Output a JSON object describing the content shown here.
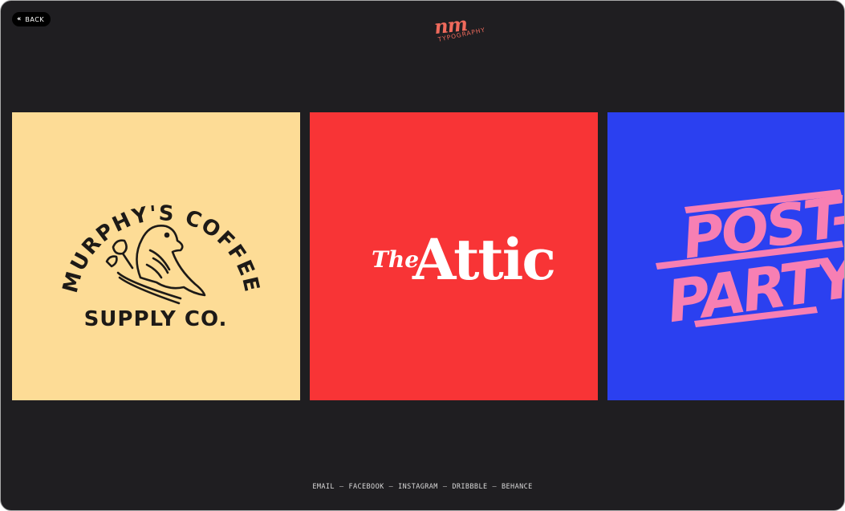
{
  "header": {
    "back_label": "BACK",
    "logo_mark": "nm",
    "logo_word": "TYPOGRAPHY"
  },
  "cards": [
    {
      "name": "murphys-coffee",
      "line1": "MURPHY'S COFFEE",
      "line2": "SUPPLY CO.",
      "background": "#fddc96",
      "ink": "#1d1a17"
    },
    {
      "name": "the-attic",
      "the": "The",
      "title": "Attic",
      "background": "#f83436",
      "ink": "#ffffff"
    },
    {
      "name": "post-party",
      "line1": "POST-",
      "line2": "PARTY",
      "background": "#2b40f0",
      "ink": "#f77fb3"
    }
  ],
  "footer": {
    "links": [
      "EMAIL",
      "FACEBOOK",
      "INSTAGRAM",
      "DRIBBBLE",
      "BEHANCE"
    ],
    "separator": "—"
  }
}
